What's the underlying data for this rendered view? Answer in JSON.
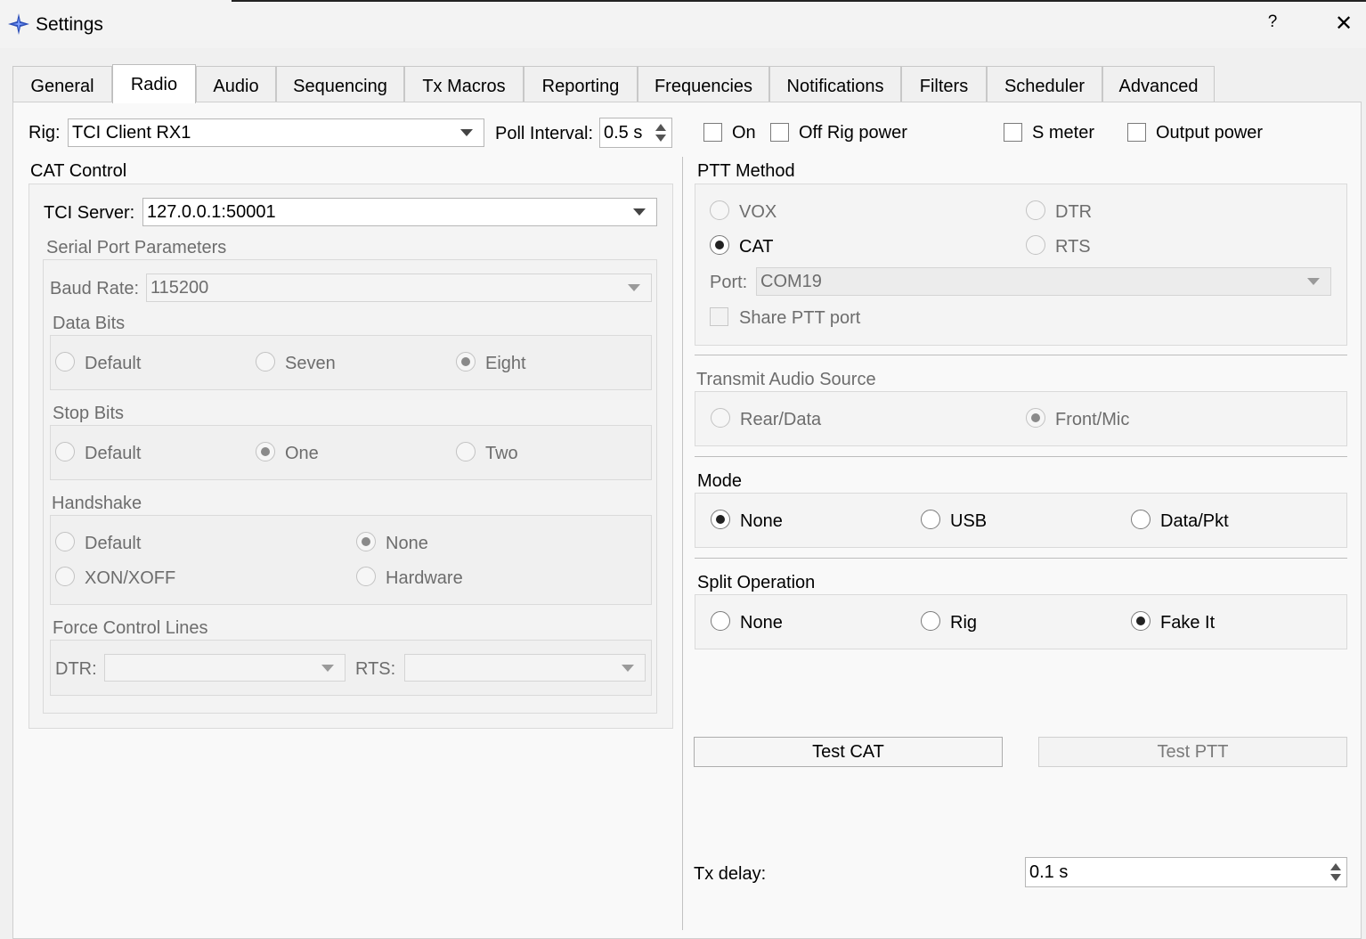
{
  "window": {
    "title": "Settings",
    "help": "?",
    "close": "✕"
  },
  "tabs": [
    "General",
    "Radio",
    "Audio",
    "Sequencing",
    "Tx Macros",
    "Reporting",
    "Frequencies",
    "Notifications",
    "Filters",
    "Scheduler",
    "Advanced"
  ],
  "rig": {
    "label": "Rig:",
    "value": "TCI Client RX1",
    "poll_label": "Poll Interval:",
    "poll_value": "0.5 s",
    "checkboxes": {
      "on": "On",
      "off_rig_power": "Off Rig power",
      "s_meter": "S meter",
      "output_power": "Output power"
    }
  },
  "cat": {
    "title": "CAT Control",
    "server_label": "TCI Server:",
    "server_value": "127.0.0.1:50001",
    "serial_title": "Serial Port Parameters",
    "baud_label": "Baud Rate:",
    "baud_value": "115200",
    "data_bits": {
      "title": "Data Bits",
      "options": [
        "Default",
        "Seven",
        "Eight"
      ],
      "selected": "Eight"
    },
    "stop_bits": {
      "title": "Stop Bits",
      "options": [
        "Default",
        "One",
        "Two"
      ],
      "selected": "One"
    },
    "handshake": {
      "title": "Handshake",
      "options": [
        "Default",
        "None",
        "XON/XOFF",
        "Hardware"
      ],
      "selected": "None"
    },
    "force": {
      "title": "Force Control Lines",
      "dtr_label": "DTR:",
      "rts_label": "RTS:"
    }
  },
  "ptt": {
    "title": "PTT Method",
    "options": [
      "VOX",
      "DTR",
      "CAT",
      "RTS"
    ],
    "selected": "CAT",
    "port_label": "Port:",
    "port_value": "COM19",
    "share_label": "Share PTT port"
  },
  "audio_source": {
    "title": "Transmit Audio Source",
    "options": [
      "Rear/Data",
      "Front/Mic"
    ],
    "selected": "Front/Mic"
  },
  "mode": {
    "title": "Mode",
    "options": [
      "None",
      "USB",
      "Data/Pkt"
    ],
    "selected": "None"
  },
  "split": {
    "title": "Split Operation",
    "options": [
      "None",
      "Rig",
      "Fake It"
    ],
    "selected": "Fake It"
  },
  "buttons": {
    "test_cat": "Test CAT",
    "test_ptt": "Test PTT"
  },
  "tx_delay": {
    "label": "Tx delay:",
    "value": "0.1 s"
  }
}
